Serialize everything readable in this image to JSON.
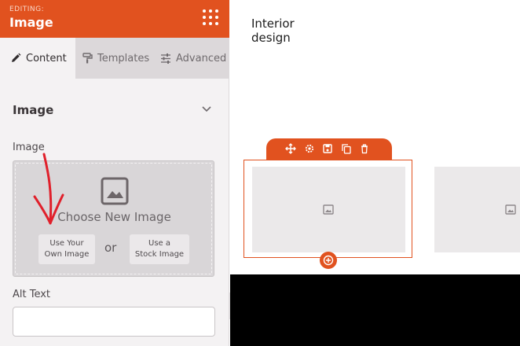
{
  "panel": {
    "editing_label": "EDITING:",
    "title": "Image",
    "menu_icon": "grid-dots-icon"
  },
  "tabs": [
    {
      "label": "Content",
      "icon": "pencil-icon",
      "active": true
    },
    {
      "label": "Templates",
      "icon": "paint-roller-icon",
      "active": false
    },
    {
      "label": "Advanced",
      "icon": "sliders-icon",
      "active": false
    }
  ],
  "section": {
    "title": "Image",
    "toggle_icon": "chevron-down-icon"
  },
  "image_field": {
    "label": "Image",
    "choose_text": "Choose New Image",
    "own_button_line1": "Use Your",
    "own_button_line2": "Own Image",
    "or_text": "or",
    "stock_button_line1": "Use a",
    "stock_button_line2": "Stock Image"
  },
  "alt_text": {
    "label": "Alt Text",
    "value": ""
  },
  "canvas": {
    "heading_line1": "Interior",
    "heading_line2": "design",
    "toolbar_icons": [
      "move-icon",
      "gear-icon",
      "save-icon",
      "duplicate-icon",
      "trash-icon"
    ],
    "add_icon": "plus-circle-icon"
  },
  "colors": {
    "accent": "#e1521f",
    "panel_bg": "#f4f2f3",
    "tab_bar": "#dcd8da",
    "annotation_arrow": "#e0202b"
  }
}
